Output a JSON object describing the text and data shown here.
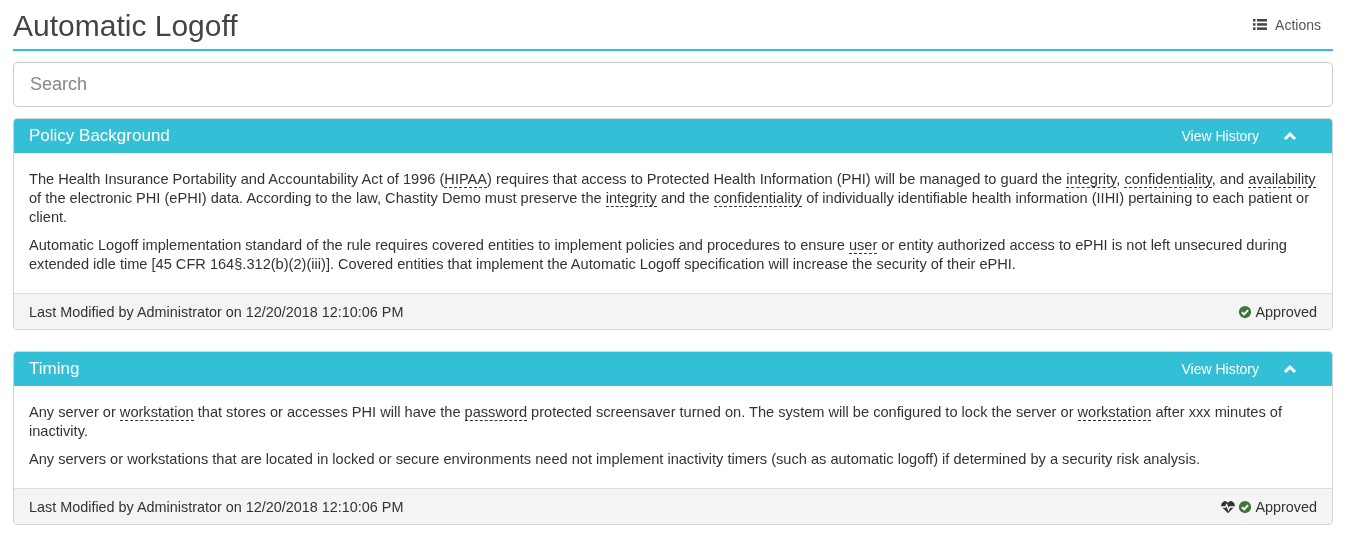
{
  "page": {
    "title": "Automatic Logoff",
    "actions_label": "Actions"
  },
  "search": {
    "placeholder": "Search"
  },
  "panels": [
    {
      "title": "Policy Background",
      "history_label": "View History",
      "expanded": true,
      "paragraphs": [
        [
          {
            "text": "The Health Insurance Portability and Accountability Act of 1996 ("
          },
          {
            "text": "HIPAA",
            "term": true
          },
          {
            "text": ") requires that access to Protected Health Information (PHI) will be managed to guard the "
          },
          {
            "text": "integrity",
            "term": true
          },
          {
            "text": ", "
          },
          {
            "text": "confidentiality",
            "term": true
          },
          {
            "text": ", and "
          },
          {
            "text": "availability",
            "term": true
          },
          {
            "text": " of the electronic PHI (ePHI) data. According to the law, Chastity Demo must preserve the "
          },
          {
            "text": "integrity",
            "term": true
          },
          {
            "text": " and the "
          },
          {
            "text": "confidentiality",
            "term": true
          },
          {
            "text": " of individually identifiable health information (IIHI) pertaining to each patient or client."
          }
        ],
        [
          {
            "text": "Automatic Logoff implementation standard of the rule requires covered entities to implement policies and procedures to ensure "
          },
          {
            "text": "user",
            "term": true
          },
          {
            "text": " or entity authorized access to ePHI is not left unsecured during extended idle time [45 CFR 164§.312(b)(2)(iii)]. Covered entities that implement the Automatic Logoff specification will increase the security of their ePHI."
          }
        ]
      ],
      "modified": "Last Modified by Administrator on 12/20/2018 12:10:06 PM",
      "monitored": false,
      "status": "Approved"
    },
    {
      "title": "Timing",
      "history_label": "View History",
      "expanded": true,
      "paragraphs": [
        [
          {
            "text": "Any server or "
          },
          {
            "text": "workstation",
            "term": true
          },
          {
            "text": " that stores or accesses PHI will have the "
          },
          {
            "text": "password",
            "term": true
          },
          {
            "text": " protected screensaver turned on. The system will be configured to lock the server or "
          },
          {
            "text": "workstation",
            "term": true
          },
          {
            "text": " after xxx minutes of inactivity."
          }
        ],
        [
          {
            "text": "Any servers or workstations that are located in locked or secure environments need not implement inactivity timers (such as automatic logoff) if determined by a security risk analysis."
          }
        ]
      ],
      "modified": "Last Modified by Administrator on 12/20/2018 12:10:06 PM",
      "monitored": true,
      "status": "Approved"
    }
  ]
}
